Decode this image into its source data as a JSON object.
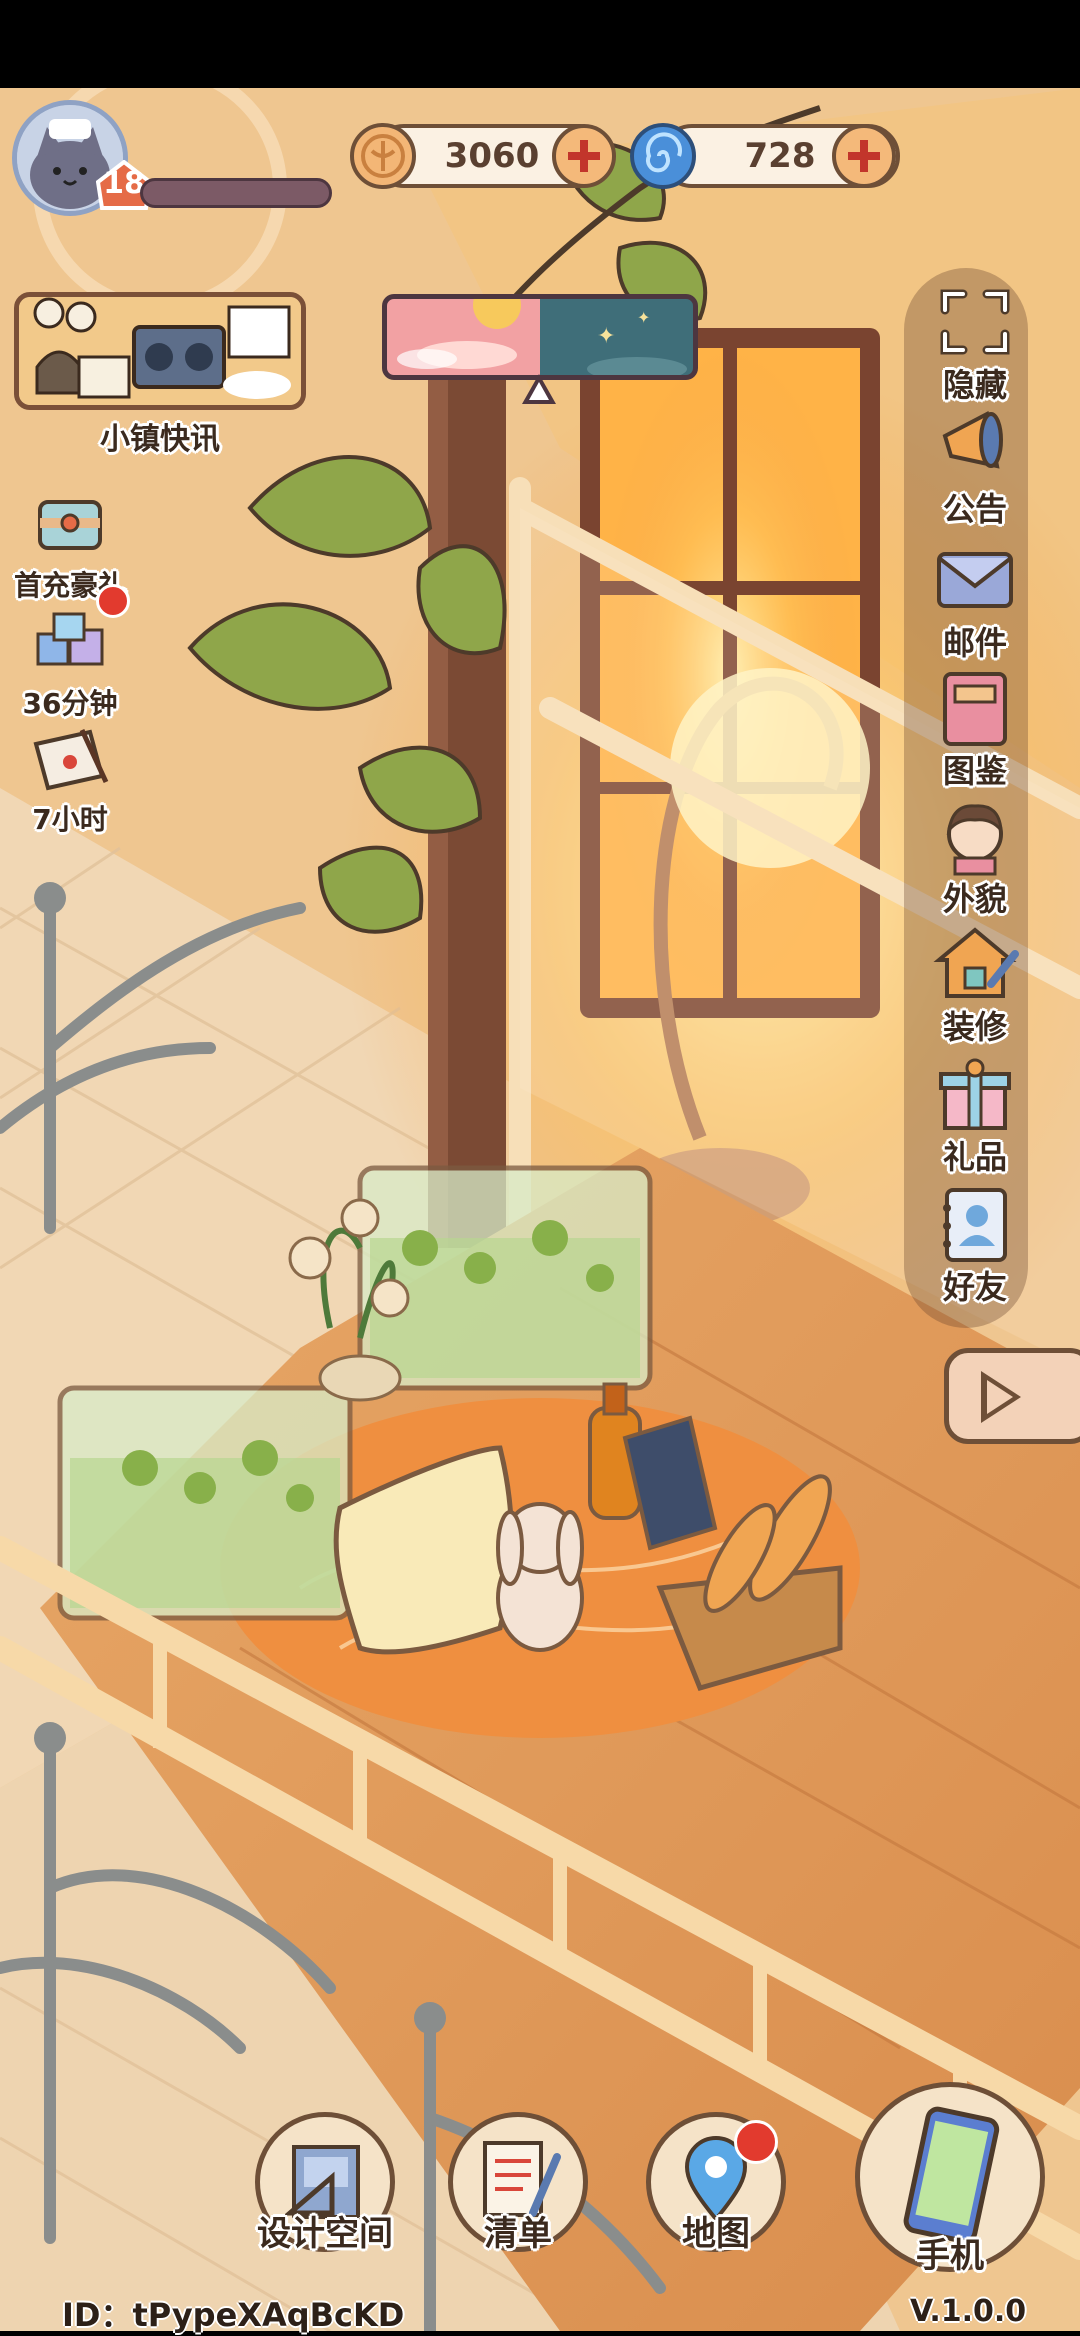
{
  "player": {
    "level": "18",
    "exp_progress": 0.0
  },
  "currencies": {
    "coins": "3060",
    "gems": "728"
  },
  "news": {
    "label": "小镇快讯"
  },
  "left_events": [
    {
      "label": "首充豪礼",
      "icon": "gift-box-icon"
    },
    {
      "label": "36分钟",
      "icon": "gift-pile-icon"
    },
    {
      "label": "7小时",
      "icon": "letter-icon"
    }
  ],
  "right_menu": [
    {
      "label": "隐藏",
      "icon": "hide-frame-icon"
    },
    {
      "label": "公告",
      "icon": "megaphone-icon"
    },
    {
      "label": "邮件",
      "icon": "mail-icon"
    },
    {
      "label": "图鉴",
      "icon": "book-icon"
    },
    {
      "label": "外貌",
      "icon": "character-icon"
    },
    {
      "label": "装修",
      "icon": "house-wrench-icon"
    },
    {
      "label": "礼品",
      "icon": "present-icon"
    },
    {
      "label": "好友",
      "icon": "friend-card-icon"
    }
  ],
  "bottom_nav": [
    {
      "label": "设计空间",
      "icon": "blueprint-icon"
    },
    {
      "label": "清单",
      "icon": "checklist-icon"
    },
    {
      "label": "地图",
      "icon": "map-pin-icon"
    },
    {
      "label": "手机",
      "icon": "phone-icon"
    }
  ],
  "footer": {
    "id": "ID：tPypeXAqBcKD",
    "version": "V.1.0.0"
  },
  "colors": {
    "outline": "#6e4f37",
    "badge_red": "#e23a2e",
    "scene_warm": "#f2b06c"
  }
}
